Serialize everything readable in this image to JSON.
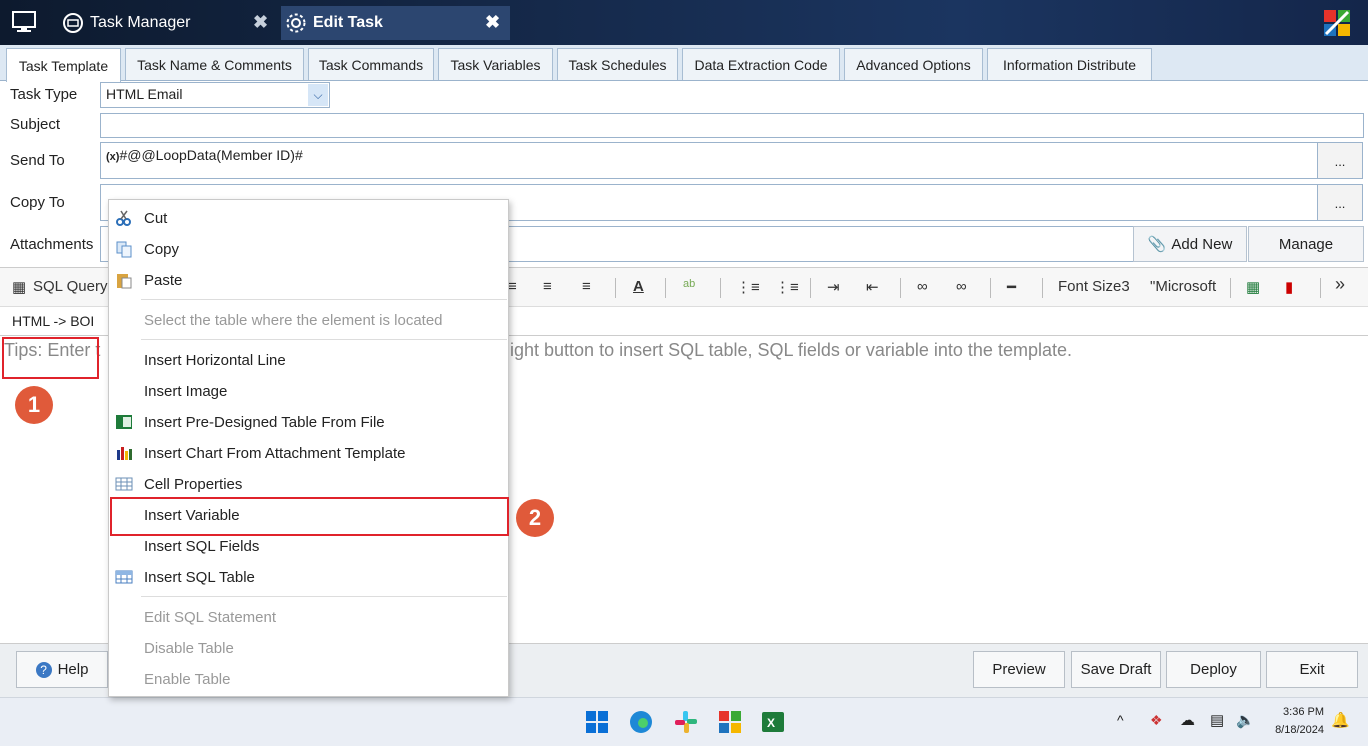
{
  "titlebar": {
    "tabs": [
      {
        "label": "Task Manager"
      },
      {
        "label": "Edit Task"
      }
    ],
    "close_glyph": "✖"
  },
  "main_tabs": [
    "Task Template",
    "Task Name & Comments",
    "Task Commands",
    "Task Variables",
    "Task Schedules",
    "Data Extraction Code",
    "Advanced Options",
    "Information Distribute"
  ],
  "form": {
    "task_type_label": "Task Type",
    "task_type_value": "HTML Email",
    "subject_label": "Subject",
    "subject_value": "",
    "send_to_label": "Send To",
    "send_to_var_tag": "(x)",
    "send_to_value": "#@@LoopData(Member ID)#",
    "copy_to_label": "Copy To",
    "attachments_label": "Attachments",
    "dots": "...",
    "add_new": "Add New",
    "manage": "Manage"
  },
  "toolbar": {
    "sql_query": "SQL Query",
    "font_size": "Font Size3",
    "font_name": "\"Microsoft",
    "more": "»"
  },
  "pathbar": {
    "text": "HTML  ->  BOI"
  },
  "editor": {
    "tips_left": "Tips: Enter t",
    "tips_right": "ight button to insert SQL table, SQL fields or variable into the template."
  },
  "context_menu": {
    "items": [
      {
        "label": "Cut",
        "icon": "scissors-icon",
        "disabled": false
      },
      {
        "label": "Copy",
        "icon": "copy-icon",
        "disabled": false
      },
      {
        "label": "Paste",
        "icon": "paste-icon",
        "disabled": false
      },
      {
        "label": "Select the table where the element is located",
        "icon": "",
        "disabled": true
      },
      {
        "label": "Insert Horizontal Line",
        "icon": "",
        "disabled": false
      },
      {
        "label": "Insert Image",
        "icon": "",
        "disabled": false
      },
      {
        "label": "Insert Pre-Designed Table From File",
        "icon": "excel-icon",
        "disabled": false
      },
      {
        "label": "Insert Chart From Attachment Template",
        "icon": "chart-icon",
        "disabled": false
      },
      {
        "label": "Cell Properties",
        "icon": "table-icon",
        "disabled": false
      },
      {
        "label": "Insert Variable",
        "icon": "",
        "disabled": false
      },
      {
        "label": "Insert SQL Fields",
        "icon": "",
        "disabled": false
      },
      {
        "label": "Insert SQL Table",
        "icon": "sql-table-icon",
        "disabled": false
      },
      {
        "label": "Edit SQL Statement",
        "icon": "",
        "disabled": true
      },
      {
        "label": "Disable Table",
        "icon": "",
        "disabled": true
      },
      {
        "label": "Enable Table",
        "icon": "",
        "disabled": true
      }
    ]
  },
  "callouts": {
    "one": "1",
    "two": "2"
  },
  "bottom": {
    "help": "Help",
    "preview": "Preview",
    "save_draft": "Save Draft",
    "deploy": "Deploy",
    "exit": "Exit"
  },
  "taskbar": {
    "time": "3:36 PM",
    "date": "8/18/2024",
    "chevron": "^"
  },
  "colors": {
    "accent_red": "#e0232b",
    "badge": "#e05a3a",
    "titlebar": "#15294a"
  }
}
